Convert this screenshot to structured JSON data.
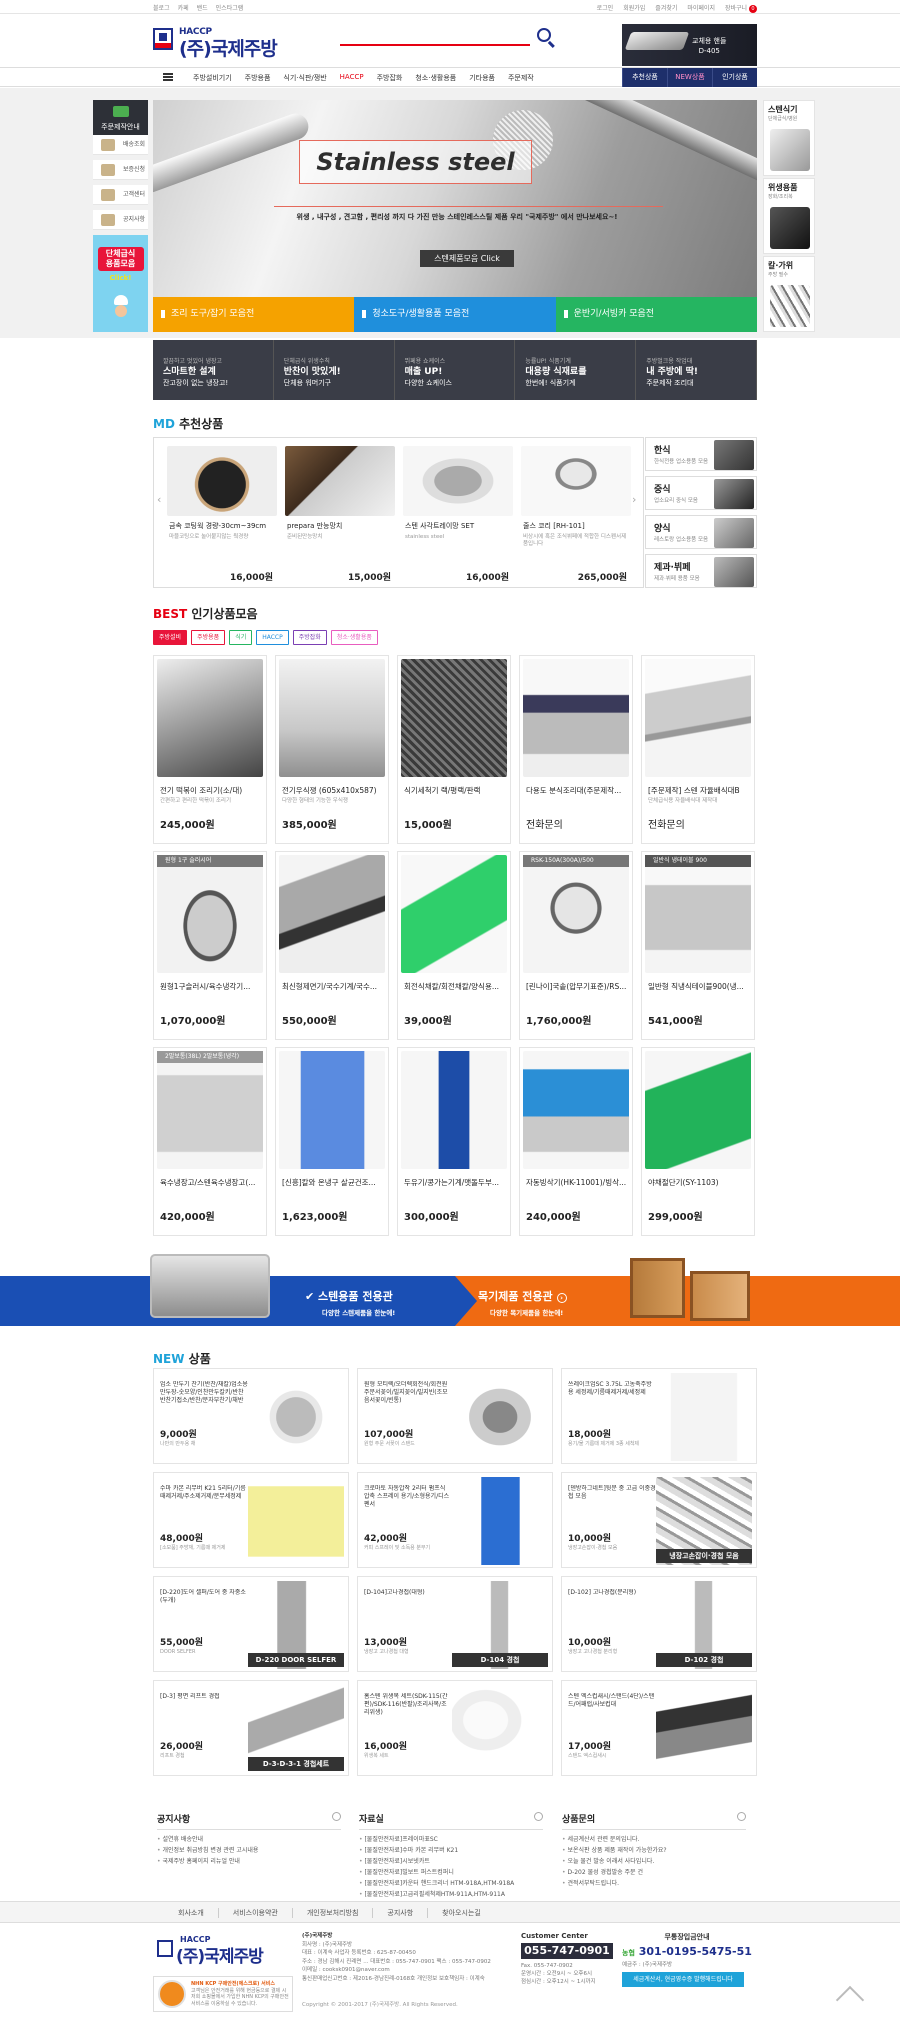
{
  "topbar": {
    "left_links": [
      "블로그",
      "카페",
      "밴드",
      "인스타그램"
    ],
    "right_links": [
      "로그인",
      "회원가입",
      "즐겨찾기",
      "마이페이지",
      "장바구니"
    ],
    "cart_count": "0"
  },
  "header": {
    "logo_haccp": "HACCP",
    "logo_name": "(주)국제주방",
    "logo_sub": "KUKJE",
    "banner_text": "교체용 핸들",
    "banner_model": "D-405"
  },
  "nav": {
    "items": [
      "주방설비기기",
      "주방용품",
      "식기·식판/쟁반",
      "HACCP",
      "주방잡화",
      "청소·생활용품",
      "기타용품",
      "주문제작"
    ],
    "tabs": [
      "추천상품",
      "NEW상품",
      "인기상품"
    ]
  },
  "left_sidebar": {
    "header": "주문제작안내",
    "items": [
      "배송조회",
      "보증신청",
      "고객센터",
      "공지사항"
    ],
    "promo_line1": "단체급식",
    "promo_line2": "용품모음",
    "promo_line3": "Click!"
  },
  "hero": {
    "title": "Stainless steel",
    "subtitle": "위생 , 내구성 , 견고함 , 편리성 까지 다 가진 만능 스테인레스스틸 제품 우리 \"국제주방\" 에서 만나보세요~!",
    "button": "스텐제품모음 Click",
    "tabs": [
      {
        "label": "조리 도구/잡기 모음전",
        "color": "#f5a200"
      },
      {
        "label": "청소도구/생활용품 모음전",
        "color": "#1f8fdc"
      },
      {
        "label": "운반기/서빙카 모음전",
        "color": "#25b561"
      }
    ]
  },
  "right_sidebar": [
    {
      "title": "스텐식기",
      "sub": "단체급식/병원"
    },
    {
      "title": "위생용품",
      "sub": "장화/조리복"
    },
    {
      "title": "칼·가위",
      "sub": "주방 필수"
    }
  ],
  "promo_strip": [
    {
      "line1": "깔끔하고 멋있어 냉장고",
      "line2": "스마트한 설계",
      "line3": "잔고장이 없는 냉장고!"
    },
    {
      "line1": "단체급식 위생수칙",
      "line2": "반찬이 맛있게!",
      "line3": "단체용 워머기구"
    },
    {
      "line1": "뷔페용 쇼케이스",
      "line2": "매출 UP!",
      "line3": "다양한 쇼케이스"
    },
    {
      "line1": "능률UP! 식품기계",
      "line2": "대용량 식재료를",
      "line3": "한번에! 식품기계"
    },
    {
      "line1": "주방벌크용 작업대",
      "line2": "내 주방에 딱!",
      "line3": "주문제작 조리대"
    }
  ],
  "md": {
    "title_en": "MD",
    "title_ko": "추천상품",
    "products": [
      {
        "name": "금속 코팅웍 경량-30cm~39cm",
        "desc": "마블코팅으로 눌어붙지않는 웍경량",
        "price": "16,000원"
      },
      {
        "name": "prepara 만능망치",
        "desc": "준비된만능망치",
        "price": "15,000원"
      },
      {
        "name": "스텐 사각트레이망 SET",
        "desc": "stainless steel",
        "price": "16,000원"
      },
      {
        "name": "줄스 코리 [RH-101]",
        "desc": "비상시에 혹은 조식뷔페에 적합한 디스펜서제품입니다",
        "price": "265,000원"
      }
    ],
    "categories": [
      {
        "title": "한식",
        "sub": "한식전용 업소용품 모음"
      },
      {
        "title": "중식",
        "sub": "업소요리 중식 모음"
      },
      {
        "title": "양식",
        "sub": "레스토랑 업소용품 모음"
      },
      {
        "title": "제과·뷔페",
        "sub": "제과·뷔페 용품 모음"
      }
    ]
  },
  "best": {
    "title_en": "BEST",
    "title_ko": "인기상품모음",
    "tabs": [
      {
        "label": "주방설비",
        "color": "#e8153a",
        "active": true
      },
      {
        "label": "주방용품",
        "color": "#e8153a",
        "active": false
      },
      {
        "label": "식기",
        "color": "#25b561",
        "active": false
      },
      {
        "label": "HACCP",
        "color": "#1f8fdc",
        "active": false
      },
      {
        "label": "주방잡화",
        "color": "#7b3fb3",
        "active": false
      },
      {
        "label": "청소·생활용품",
        "color": "#e85dbf",
        "active": false
      }
    ],
    "products": [
      {
        "name": "전기 떡볶이 조리기(소/대)",
        "desc": "간편하고 편리한 떡볶이 조리기",
        "price": "245,000원",
        "tag": ""
      },
      {
        "name": "전기우식쟁 (605x410x587)",
        "desc": "다양한 형태의 기능한 우식쟁",
        "price": "385,000원",
        "tag": ""
      },
      {
        "name": "식기세척기 랙/평랙/판랙",
        "desc": "",
        "price": "15,000원",
        "tag": ""
      },
      {
        "name": "다용도 분식조리대(주문제작...",
        "desc": "",
        "price": "전화문의",
        "tag": ""
      },
      {
        "name": "[주문제작] 스텐 자율배식대B",
        "desc": "단체급식용 자율배식대 제작대",
        "price": "전화문의",
        "tag": ""
      },
      {
        "name": "원형1구슬러시/육수냉각기...",
        "desc": "",
        "price": "1,070,000원",
        "tag": "원형 1구 슬러시어"
      },
      {
        "name": "최신형제면기/국수기계/국수...",
        "desc": "",
        "price": "550,000원",
        "tag": ""
      },
      {
        "name": "회전식채칼/회전채칼/양식용...",
        "desc": "",
        "price": "39,000원",
        "tag": ""
      },
      {
        "name": "[린나이]국솥(압무기표준)/RS...",
        "desc": "",
        "price": "1,760,000원",
        "tag": "RSK-150A(300A)/500"
      },
      {
        "name": "일반형 직냉식테이블900(냉...",
        "desc": "",
        "price": "541,000원",
        "tag": "일반식 냉테이블 900"
      },
      {
        "name": "육수냉장고/스텐육수냉장고(...",
        "desc": "",
        "price": "420,000원",
        "tag": "2말보통(38L) 2말보통(냉각)"
      },
      {
        "name": "[신흥]칼와 온냉구 살균건조...",
        "desc": "",
        "price": "1,623,000원",
        "tag": ""
      },
      {
        "name": "두유기/콩가는기계/맷돌두부...",
        "desc": "",
        "price": "300,000원",
        "tag": ""
      },
      {
        "name": "자동빙삭기(HK-11001)/빙삭...",
        "desc": "",
        "price": "240,000원",
        "tag": ""
      },
      {
        "name": "야채절단기(SY-1103)",
        "desc": "",
        "price": "299,000원",
        "tag": ""
      }
    ]
  },
  "dual_banner": {
    "left_title": "스텐용품 전용관",
    "left_sub": "다양한 스텐제품을 한눈에!",
    "right_title": "목기제품 전용관",
    "right_sub": "다양한 목기제품을 한눈에!"
  },
  "new": {
    "title_en": "NEW",
    "title_ko": "상품",
    "products": [
      {
        "name": "업소 만두기 찬기(반찬/채칼)업소용만두장-숫모양/인찬만두칼키/반찬반찬기접소/반찬/분자부찬기/채반",
        "price": "9,000원",
        "desc": "나만의 만두용 채",
        "cap": ""
      },
      {
        "name": "원형 모티렉/오더렉회전식/회전원주문서꽂이/빌지꽂이/빌지빈(조모음서꽃이/빈통)",
        "price": "107,000원",
        "desc": "원형 주문 서꽂이 스탠드",
        "cap": ""
      },
      {
        "name": "쓰레이크업SC 3.75L 고농축주방용 세정제/기름때제거제/세정제",
        "price": "18,000원",
        "desc": "용기/물 기름때 제거제 3종 세척제",
        "cap": ""
      },
      {
        "name": "수마 카본 리무버 K21 5리터/기름때제거제/주소제거제/분무세정제",
        "price": "48,000원",
        "desc": "[소모품] 주방재, 기름때 제거제",
        "cap": ""
      },
      {
        "name": "크로마토 자동압착 2리터 펌프식 압축 스프레이 용기/소형용기/디스펜서",
        "price": "42,000원",
        "desc": "커피 스프레이 및 소독용 분무기",
        "cap": ""
      },
      {
        "name": "[덴방하그네트]뒷문 중 고급 이중경첩 모음",
        "price": "10,000원",
        "desc": "냉장고손잡이·경첩 모음",
        "cap": "냉장고손잡이·경첩 모음"
      },
      {
        "name": "[D-220]도어 셀퍼/도어 중 자중소(두개)",
        "price": "55,000원",
        "desc": "DOOR SELFER",
        "cap": "D-220 DOOR SELFER"
      },
      {
        "name": "[D-104]고나경첩(대형)",
        "price": "13,000원",
        "desc": "냉장고 고나경첩 대형",
        "cap": "D-104 경첩"
      },
      {
        "name": "[D-102] 고나경첩(분리형)",
        "price": "10,000원",
        "desc": "냉장고 고나경첩 분리형",
        "cap": "D-102 경첩"
      },
      {
        "name": "[D-3] 평면 리프트 경첩",
        "price": "26,000원",
        "desc": "리프트 경첩",
        "cap": "D-3-D-3-1 경첩세트"
      },
      {
        "name": "홈스텐 위생복 세트(SDK-115(간편)/SDK-116(반팔)/조리사복/조리위생)",
        "price": "16,000원",
        "desc": "위생복 세트",
        "cap": ""
      },
      {
        "name": "스텐 엑스컵새시/스탠드(4단)/스탠드/어패럽/사보컵대",
        "price": "17,000원",
        "desc": "스탠드 엑스컵새시",
        "cap": ""
      }
    ]
  },
  "boards": [
    {
      "title": "공지사항",
      "items": [
        "설연휴 배송안내",
        "개인정보 취급방침 변경 관련 고시내용",
        "국제주방 홈페이지 리뉴얼 안내"
      ]
    },
    {
      "title": "자료실",
      "items": [
        "[물질안전자료]프레이마표SC",
        "[물질안전자료]수마 카본 리무버 K21",
        "[물질안전자료]시보넷카트",
        "[물질안전자료]빌보트 퍼스트컴퍼니",
        "[물질안전자료]카운터 핸드크리너 HTM-918A,HTM-918A",
        "[물질안전자료]고급리필세척제HTM-911A,HTM-911A"
      ]
    },
    {
      "title": "상품문의",
      "items": [
        "세금계산서 관련 문의입니다.",
        "보온식판 상품 제품 재작이 가능한가요?",
        "오늘 물건 발송 이래서 사다입니다.",
        "D-202 물성 경첩발송 주문 건",
        "견적서부탁드립니다."
      ]
    }
  ],
  "footer": {
    "nav": [
      "회사소개",
      "서비스이용약관",
      "개인정보처리방침",
      "공지사항",
      "찾아오시는길"
    ],
    "company_lines": [
      "(주)국제주방",
      "회사명 : (주)국제주방",
      "대표 : 이계숙     사업자 등록번호 : 625-87-00450",
      "주소 : 경남 김해시 진례면 ... 대표번호 : 055-747-0901  팩스 : 055-747-0902",
      "이메일 : cooksk0901@naver.com",
      "통신판매업신고번호 : 제2016-경남진례-0168호   개인정보 보호책임자 : 이계숙"
    ],
    "copyright": "Copyright © 2001-2017 (주)국제주방. All Rights Reserved.",
    "cs_title": "Customer Center",
    "cs_tel": "055-747-0901",
    "cs_other": [
      "Fax. 055-747-0902",
      "운영시간 : 오전9시 ~ 오후6시",
      "점심시간 : 오후12시 ~ 1시까지"
    ],
    "bank_title": "무통장입금안내",
    "bank_name": "농협",
    "bank_account": "301-0195-5475-51",
    "bank_owner": "예금주 : (주)국제주방",
    "bank_button": "세금계산서, 현금영수증 발행해드립니다",
    "badge_title": "NHN KCP 구매안전(에스크로) 서비스",
    "badge_text": "고객님은 안전거래를 위해 현금등으로 결제 시 저희 쇼핑몰에서 가입한 NHN KCP의 구매안전서비스를 이용하실 수 있습니다."
  },
  "colors": {
    "brand_navy": "#1e2f8c",
    "accent_red": "#e60012",
    "accent_blue": "#1fa3d9"
  }
}
